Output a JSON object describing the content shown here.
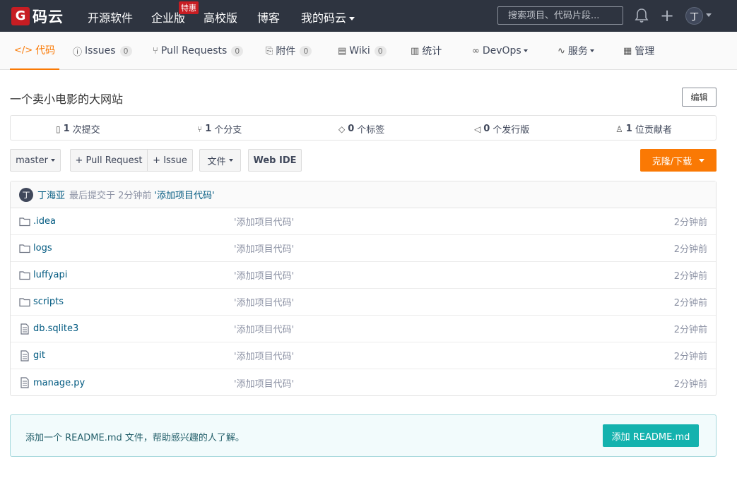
{
  "nav": {
    "logo_glyph": "G",
    "logo_text": "码云",
    "items": [
      "开源软件",
      "企业版",
      "高校版",
      "博客",
      "我的码云"
    ],
    "hot_badge": "特惠",
    "search_placeholder": "搜索项目、代码片段...",
    "avatar_initial": "丁"
  },
  "tabs": [
    {
      "label": "代码",
      "icon": "code-icon"
    },
    {
      "label": "Issues",
      "count": "0",
      "icon": "issue-icon"
    },
    {
      "label": "Pull Requests",
      "count": "0",
      "icon": "pull-request-icon"
    },
    {
      "label": "附件",
      "count": "0",
      "icon": "attachment-icon"
    },
    {
      "label": "Wiki",
      "count": "0",
      "icon": "wiki-icon"
    },
    {
      "label": "统计",
      "icon": "chart-icon"
    },
    {
      "label": "DevOps",
      "icon": "infinity-icon"
    },
    {
      "label": "服务",
      "icon": "pulse-icon"
    },
    {
      "label": "管理",
      "icon": "manage-icon"
    }
  ],
  "repo": {
    "description": "一个卖小电影的大网站",
    "edit_label": "编辑"
  },
  "stats": [
    {
      "count": "1",
      "label": "次提交",
      "icon": "commit-icon"
    },
    {
      "count": "1",
      "label": "个分支",
      "icon": "branch-icon"
    },
    {
      "count": "0",
      "label": "个标签",
      "icon": "tag-icon"
    },
    {
      "count": "0",
      "label": "个发行版",
      "icon": "release-icon"
    },
    {
      "count": "1",
      "label": "位贡献者",
      "icon": "contributors-icon"
    }
  ],
  "toolbar": {
    "branch": "master",
    "pull_request": "+ Pull Request",
    "issue": "+ Issue",
    "file": "文件",
    "web_ide": "Web IDE",
    "clone": "克隆/下载"
  },
  "commit": {
    "avatar_initial": "丁",
    "author": "丁海亚",
    "meta": "最后提交于 2分钟前",
    "message": "'添加项目代码'"
  },
  "files": [
    {
      "name": ".idea",
      "type": "folder",
      "message": "'添加项目代码'",
      "time": "2分钟前"
    },
    {
      "name": "logs",
      "type": "folder",
      "message": "'添加项目代码'",
      "time": "2分钟前"
    },
    {
      "name": "luffyapi",
      "type": "folder",
      "message": "'添加项目代码'",
      "time": "2分钟前"
    },
    {
      "name": "scripts",
      "type": "folder",
      "message": "'添加项目代码'",
      "time": "2分钟前"
    },
    {
      "name": "db.sqlite3",
      "type": "file",
      "message": "'添加项目代码'",
      "time": "2分钟前"
    },
    {
      "name": "git",
      "type": "file",
      "message": "'添加项目代码'",
      "time": "2分钟前"
    },
    {
      "name": "manage.py",
      "type": "file",
      "message": "'添加项目代码'",
      "time": "2分钟前"
    }
  ],
  "readme": {
    "text": "添加一个 README.md 文件，帮助感兴趣的人了解。",
    "button": "添加 README.md"
  },
  "colors": {
    "accent": "#fa7904",
    "nav_bg": "#2e3440",
    "brand_red": "#c71d23",
    "readme_button": "#14b2ae",
    "link": "#005980"
  }
}
